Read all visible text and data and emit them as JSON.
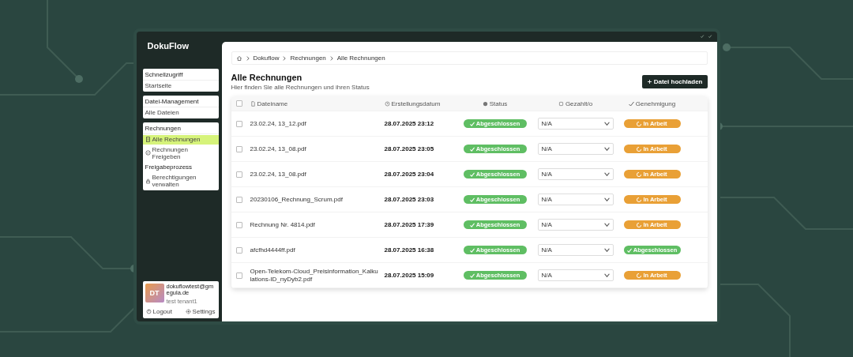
{
  "app": {
    "logo": "DokuFlow"
  },
  "sidebar": {
    "sections": [
      {
        "title": "Schnellzugriff",
        "items": [
          {
            "label": "Startseite",
            "selected": false
          }
        ]
      },
      {
        "title": "Datei-Management",
        "items": [
          {
            "label": "Alle Dateien",
            "selected": false
          }
        ]
      },
      {
        "title": "Rechnungen",
        "items": [
          {
            "label": "Alle Rechnungen",
            "selected": true
          },
          {
            "label": "Rechnungen Freigeben",
            "selected": false
          }
        ],
        "subtitle": "Freigabeprozess",
        "subitems": [
          {
            "label": "Berechtigungen verwalten",
            "selected": false
          }
        ]
      }
    ]
  },
  "user": {
    "initials": "DT",
    "email": "dokuflowtest@gm egula.de",
    "tenant": "test tenant1",
    "buttons": [
      "Logout",
      "Settings"
    ]
  },
  "breadcrumb": [
    "Dokuflow",
    "Rechnungen",
    "Alle Rechnungen"
  ],
  "page": {
    "title": "Alle Rechnungen",
    "subtitle": "Hier finden Sie alle Rechnungen und ihren Status",
    "upload_button": "Datei hochladen"
  },
  "table": {
    "select_all_checked": false,
    "columns": [
      "Dateiname",
      "Erstellungsdatum",
      "Status",
      "Gezahlt/o",
      "Genehmigung"
    ],
    "rows": [
      {
        "checked": false,
        "name": "23.02.24, 13_12.pdf",
        "date": "28.07.2025 23:12",
        "status": {
          "kind": "done",
          "label": "Abgeschlossen"
        },
        "paid": "N/A",
        "approval": {
          "kind": "progress",
          "label": "In Arbeit"
        }
      },
      {
        "checked": false,
        "name": "23.02.24, 13_08.pdf",
        "date": "28.07.2025 23:05",
        "status": {
          "kind": "done",
          "label": "Abgeschlossen"
        },
        "paid": "N/A",
        "approval": {
          "kind": "progress",
          "label": "In Arbeit"
        }
      },
      {
        "checked": false,
        "name": "23.02.24, 13_08.pdf",
        "date": "28.07.2025 23:04",
        "status": {
          "kind": "done",
          "label": "Abgeschlossen"
        },
        "paid": "N/A",
        "approval": {
          "kind": "progress",
          "label": "In Arbeit"
        }
      },
      {
        "checked": false,
        "name": "20230106_Rechnung_Scrum.pdf",
        "date": "28.07.2025 23:03",
        "status": {
          "kind": "done",
          "label": "Abgeschlossen"
        },
        "paid": "N/A",
        "approval": {
          "kind": "progress",
          "label": "In Arbeit"
        }
      },
      {
        "checked": false,
        "name": "Rechnung Nr. 4814.pdf",
        "date": "28.07.2025 17:39",
        "status": {
          "kind": "done",
          "label": "Abgeschlossen"
        },
        "paid": "N/A",
        "approval": {
          "kind": "progress",
          "label": "In Arbeit"
        }
      },
      {
        "checked": false,
        "name": "afcfhd4444ff.pdf",
        "date": "28.07.2025 16:38",
        "status": {
          "kind": "done",
          "label": "Abgeschlossen"
        },
        "paid": "N/A",
        "approval": {
          "kind": "done",
          "label": "Abgeschlossen"
        }
      },
      {
        "checked": false,
        "name": "Open-Telekom-Cloud_Preisinformation_Kalkulations-ID_nyDyb2.pdf",
        "date": "28.07.2025 15:09",
        "status": {
          "kind": "done",
          "label": "Abgeschlossen"
        },
        "paid": "N/A",
        "approval": {
          "kind": "progress",
          "label": "In Arbeit"
        }
      }
    ]
  }
}
